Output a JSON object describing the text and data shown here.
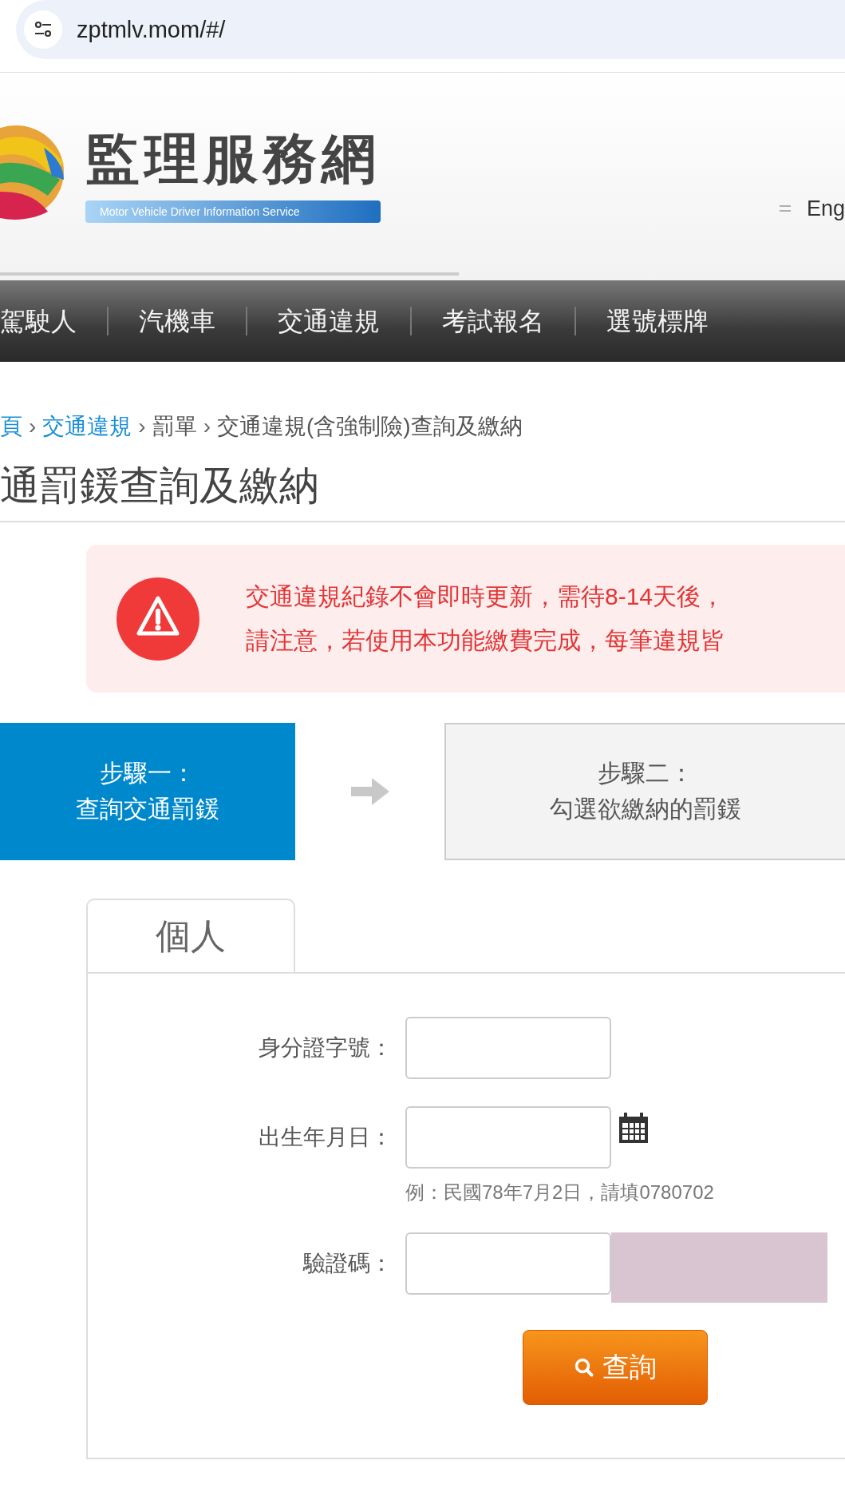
{
  "address_bar": {
    "url": "zptmlv.mom/#/"
  },
  "header": {
    "logo_title": "監理服務網",
    "logo_subtitle": "Motor Vehicle Driver Information Service",
    "language_link": "Eng"
  },
  "nav": [
    "駕駛人",
    "汽機車",
    "交通違規",
    "考試報名",
    "選號標牌"
  ],
  "breadcrumb": {
    "separator": "›",
    "items": [
      {
        "label": "頁",
        "link": true
      },
      {
        "label": "交通違規",
        "link": true
      },
      {
        "label": "罰單",
        "link": false
      },
      {
        "label": "交通違規(含強制險)查詢及繳納",
        "link": false
      }
    ]
  },
  "page_title": "通罰鍰查詢及繳納",
  "alert": {
    "lines": [
      "交通違規紀錄不會即時更新，需待8-14天後，",
      "請注意，若使用本功能繳費完成，每筆違規皆"
    ]
  },
  "steps": [
    {
      "label": "步驟一：",
      "desc": "查詢交通罰鍰",
      "selected": true
    },
    {
      "label": "步驟二：",
      "desc": "勾選欲繳納的罰鍰",
      "selected": false
    }
  ],
  "tabs": [
    {
      "label": "個人",
      "selected": true
    }
  ],
  "form": {
    "fields": [
      {
        "label": "身分證字號：",
        "kind": "text"
      },
      {
        "label": "出生年月日：",
        "kind": "date",
        "hint": "例：民國78年7月2日，請填0780702"
      },
      {
        "label": "驗證碼：",
        "kind": "captcha"
      }
    ],
    "submit": "查詢"
  }
}
